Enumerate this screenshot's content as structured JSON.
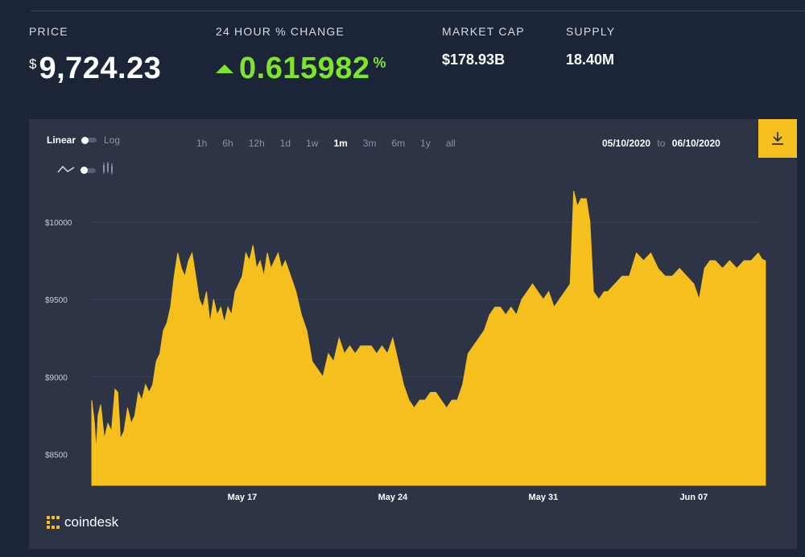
{
  "header": {
    "price": {
      "label": "PRICE",
      "currency": "$",
      "value": "9,724.23"
    },
    "change": {
      "label": "24 HOUR % CHANGE",
      "value": "0.615982",
      "unit": "%",
      "color": "#7ee52d"
    },
    "market_cap": {
      "label": "MARKET CAP",
      "value": "$178.93B"
    },
    "supply": {
      "label": "SUPPLY",
      "value": "18.40M"
    }
  },
  "controls": {
    "scale_linear": "Linear",
    "scale_log": "Log",
    "ranges": [
      "1h",
      "6h",
      "12h",
      "1d",
      "1w",
      "1m",
      "3m",
      "6m",
      "1y",
      "all"
    ],
    "active_range": "1m",
    "date_from": "05/10/2020",
    "date_to_word": "to",
    "date_to": "06/10/2020",
    "download_icon": "download-icon",
    "accent": "#f5bf1d"
  },
  "brand": {
    "name": "coindesk",
    "icon": "coindesk-logo-icon"
  },
  "chart_data": {
    "type": "area",
    "title": "",
    "xlabel": "",
    "ylabel": "",
    "x_range": [
      "2020-05-10",
      "2020-06-10"
    ],
    "x_ticks": [
      {
        "label": "May 17",
        "date": "2020-05-17"
      },
      {
        "label": "May 24",
        "date": "2020-05-24"
      },
      {
        "label": "May 31",
        "date": "2020-05-31"
      },
      {
        "label": "Jun 07",
        "date": "2020-06-07"
      }
    ],
    "y_ticks": [
      {
        "label": "$10000",
        "value": 10000
      },
      {
        "label": "$9500",
        "value": 9500
      },
      {
        "label": "$9000",
        "value": 9000
      },
      {
        "label": "$8500",
        "value": 8500
      }
    ],
    "ylim": [
      8300,
      10300
    ],
    "grid": "horizontal",
    "color": "#f5bf1d",
    "series": [
      {
        "points": [
          [
            "2020-05-10 00:00",
            8850
          ],
          [
            "2020-05-10 03:00",
            8700
          ],
          [
            "2020-05-10 05:00",
            8520
          ],
          [
            "2020-05-10 07:00",
            8750
          ],
          [
            "2020-05-10 10:00",
            8820
          ],
          [
            "2020-05-10 14:00",
            8600
          ],
          [
            "2020-05-10 18:00",
            8700
          ],
          [
            "2020-05-10 22:00",
            8650
          ],
          [
            "2020-05-11 02:00",
            8920
          ],
          [
            "2020-05-11 05:00",
            8900
          ],
          [
            "2020-05-11 08:00",
            8600
          ],
          [
            "2020-05-11 12:00",
            8650
          ],
          [
            "2020-05-11 16:00",
            8800
          ],
          [
            "2020-05-11 20:00",
            8700
          ],
          [
            "2020-05-12 00:00",
            8750
          ],
          [
            "2020-05-12 04:00",
            8900
          ],
          [
            "2020-05-12 08:00",
            8850
          ],
          [
            "2020-05-12 12:00",
            8950
          ],
          [
            "2020-05-12 16:00",
            8900
          ],
          [
            "2020-05-12 20:00",
            8950
          ],
          [
            "2020-05-13 00:00",
            9100
          ],
          [
            "2020-05-13 04:00",
            9150
          ],
          [
            "2020-05-13 08:00",
            9300
          ],
          [
            "2020-05-13 12:00",
            9350
          ],
          [
            "2020-05-13 16:00",
            9450
          ],
          [
            "2020-05-13 20:00",
            9650
          ],
          [
            "2020-05-14 00:00",
            9800
          ],
          [
            "2020-05-14 04:00",
            9700
          ],
          [
            "2020-05-14 08:00",
            9650
          ],
          [
            "2020-05-14 12:00",
            9750
          ],
          [
            "2020-05-14 16:00",
            9800
          ],
          [
            "2020-05-14 20:00",
            9650
          ],
          [
            "2020-05-15 00:00",
            9500
          ],
          [
            "2020-05-15 04:00",
            9450
          ],
          [
            "2020-05-15 08:00",
            9550
          ],
          [
            "2020-05-15 12:00",
            9350
          ],
          [
            "2020-05-15 16:00",
            9500
          ],
          [
            "2020-05-15 20:00",
            9400
          ],
          [
            "2020-05-16 00:00",
            9450
          ],
          [
            "2020-05-16 04:00",
            9350
          ],
          [
            "2020-05-16 08:00",
            9450
          ],
          [
            "2020-05-16 12:00",
            9400
          ],
          [
            "2020-05-16 16:00",
            9550
          ],
          [
            "2020-05-16 20:00",
            9600
          ],
          [
            "2020-05-17 00:00",
            9650
          ],
          [
            "2020-05-17 04:00",
            9800
          ],
          [
            "2020-05-17 08:00",
            9750
          ],
          [
            "2020-05-17 12:00",
            9850
          ],
          [
            "2020-05-17 16:00",
            9700
          ],
          [
            "2020-05-17 20:00",
            9750
          ],
          [
            "2020-05-18 00:00",
            9650
          ],
          [
            "2020-05-18 04:00",
            9800
          ],
          [
            "2020-05-18 08:00",
            9700
          ],
          [
            "2020-05-18 12:00",
            9750
          ],
          [
            "2020-05-18 16:00",
            9800
          ],
          [
            "2020-05-18 20:00",
            9700
          ],
          [
            "2020-05-19 00:00",
            9750
          ],
          [
            "2020-05-19 06:00",
            9650
          ],
          [
            "2020-05-19 12:00",
            9550
          ],
          [
            "2020-05-19 18:00",
            9400
          ],
          [
            "2020-05-20 00:00",
            9300
          ],
          [
            "2020-05-20 06:00",
            9100
          ],
          [
            "2020-05-20 12:00",
            9050
          ],
          [
            "2020-05-20 18:00",
            9000
          ],
          [
            "2020-05-21 00:00",
            9150
          ],
          [
            "2020-05-21 06:00",
            9100
          ],
          [
            "2020-05-21 12:00",
            9250
          ],
          [
            "2020-05-21 18:00",
            9150
          ],
          [
            "2020-05-22 00:00",
            9200
          ],
          [
            "2020-05-22 06:00",
            9150
          ],
          [
            "2020-05-22 12:00",
            9200
          ],
          [
            "2020-05-22 18:00",
            9200
          ],
          [
            "2020-05-23 00:00",
            9200
          ],
          [
            "2020-05-23 06:00",
            9150
          ],
          [
            "2020-05-23 12:00",
            9200
          ],
          [
            "2020-05-23 18:00",
            9150
          ],
          [
            "2020-05-24 00:00",
            9250
          ],
          [
            "2020-05-24 06:00",
            9100
          ],
          [
            "2020-05-24 12:00",
            8950
          ],
          [
            "2020-05-24 18:00",
            8850
          ],
          [
            "2020-05-25 00:00",
            8800
          ],
          [
            "2020-05-25 06:00",
            8850
          ],
          [
            "2020-05-25 12:00",
            8850
          ],
          [
            "2020-05-25 18:00",
            8900
          ],
          [
            "2020-05-26 00:00",
            8900
          ],
          [
            "2020-05-26 06:00",
            8850
          ],
          [
            "2020-05-26 12:00",
            8800
          ],
          [
            "2020-05-26 18:00",
            8850
          ],
          [
            "2020-05-27 00:00",
            8850
          ],
          [
            "2020-05-27 06:00",
            8950
          ],
          [
            "2020-05-27 12:00",
            9150
          ],
          [
            "2020-05-27 18:00",
            9200
          ],
          [
            "2020-05-28 00:00",
            9250
          ],
          [
            "2020-05-28 06:00",
            9300
          ],
          [
            "2020-05-28 12:00",
            9400
          ],
          [
            "2020-05-28 18:00",
            9450
          ],
          [
            "2020-05-29 00:00",
            9450
          ],
          [
            "2020-05-29 06:00",
            9400
          ],
          [
            "2020-05-29 12:00",
            9450
          ],
          [
            "2020-05-29 18:00",
            9400
          ],
          [
            "2020-05-30 00:00",
            9500
          ],
          [
            "2020-05-30 06:00",
            9550
          ],
          [
            "2020-05-30 12:00",
            9600
          ],
          [
            "2020-05-30 18:00",
            9550
          ],
          [
            "2020-05-31 00:00",
            9500
          ],
          [
            "2020-05-31 06:00",
            9550
          ],
          [
            "2020-05-31 12:00",
            9450
          ],
          [
            "2020-05-31 18:00",
            9500
          ],
          [
            "2020-06-01 00:00",
            9550
          ],
          [
            "2020-06-01 06:00",
            9600
          ],
          [
            "2020-06-01 10:00",
            10200
          ],
          [
            "2020-06-01 14:00",
            10100
          ],
          [
            "2020-06-01 18:00",
            10150
          ],
          [
            "2020-06-02 00:00",
            10150
          ],
          [
            "2020-06-02 04:00",
            10000
          ],
          [
            "2020-06-02 08:00",
            9550
          ],
          [
            "2020-06-02 14:00",
            9500
          ],
          [
            "2020-06-02 20:00",
            9550
          ],
          [
            "2020-06-03 00:00",
            9550
          ],
          [
            "2020-06-03 08:00",
            9600
          ],
          [
            "2020-06-03 16:00",
            9650
          ],
          [
            "2020-06-04 00:00",
            9650
          ],
          [
            "2020-06-04 08:00",
            9800
          ],
          [
            "2020-06-04 16:00",
            9750
          ],
          [
            "2020-06-05 00:00",
            9800
          ],
          [
            "2020-06-05 08:00",
            9700
          ],
          [
            "2020-06-05 16:00",
            9650
          ],
          [
            "2020-06-06 00:00",
            9650
          ],
          [
            "2020-06-06 08:00",
            9700
          ],
          [
            "2020-06-06 16:00",
            9650
          ],
          [
            "2020-06-07 00:00",
            9600
          ],
          [
            "2020-06-07 06:00",
            9500
          ],
          [
            "2020-06-07 12:00",
            9700
          ],
          [
            "2020-06-07 18:00",
            9750
          ],
          [
            "2020-06-08 00:00",
            9750
          ],
          [
            "2020-06-08 08:00",
            9700
          ],
          [
            "2020-06-08 16:00",
            9750
          ],
          [
            "2020-06-09 00:00",
            9700
          ],
          [
            "2020-06-09 08:00",
            9750
          ],
          [
            "2020-06-09 16:00",
            9750
          ],
          [
            "2020-06-10 00:00",
            9800
          ],
          [
            "2020-06-10 04:00",
            9760
          ],
          [
            "2020-06-10 08:00",
            9750
          ]
        ]
      }
    ]
  }
}
